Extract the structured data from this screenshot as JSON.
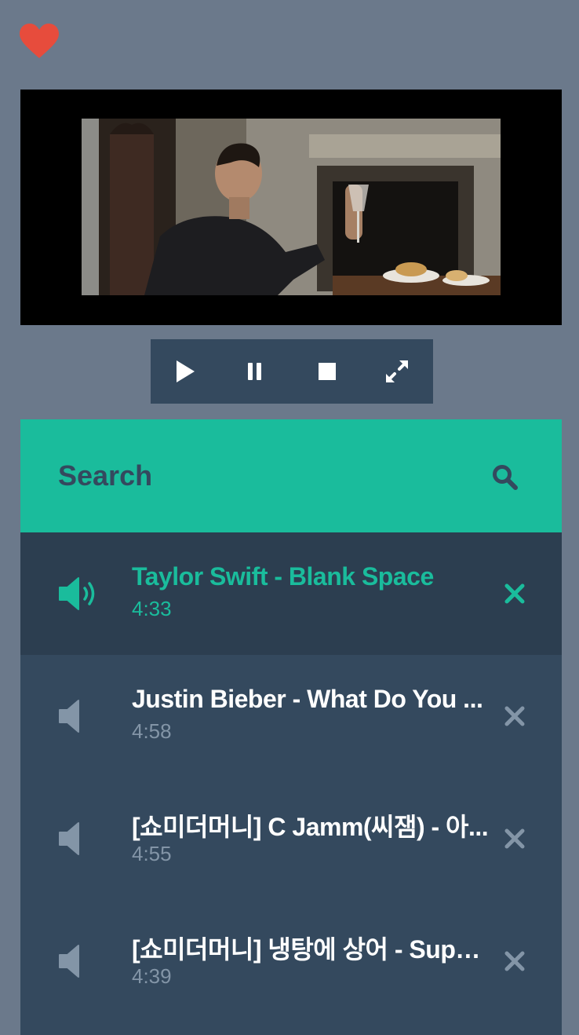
{
  "colors": {
    "background": "#6b798b",
    "accent": "#1abc9c",
    "panel": "#34495e",
    "panel_active": "#2c3e50",
    "heart": "#e74c3c",
    "muted": "#8395a7"
  },
  "favorite": {
    "icon": "heart-icon"
  },
  "player": {
    "controls": [
      {
        "name": "play",
        "icon": "play-icon"
      },
      {
        "name": "pause",
        "icon": "pause-icon"
      },
      {
        "name": "stop",
        "icon": "stop-icon"
      },
      {
        "name": "fullscreen",
        "icon": "expand-icon"
      }
    ]
  },
  "search": {
    "placeholder": "Search",
    "value": "",
    "icon": "search-icon"
  },
  "playlist": {
    "tracks": [
      {
        "title": "Taylor Swift - Blank Space",
        "duration": "4:33",
        "playing": true
      },
      {
        "title": "Justin Bieber - What Do You ...",
        "duration": "4:58",
        "playing": false
      },
      {
        "title": "[쇼미더머니] C Jamm(씨잼) - 아...",
        "duration": "4:55",
        "playing": false
      },
      {
        "title": "[쇼미더머니] 냉탕에 상어 - Super...",
        "duration": "4:39",
        "playing": false
      }
    ]
  }
}
